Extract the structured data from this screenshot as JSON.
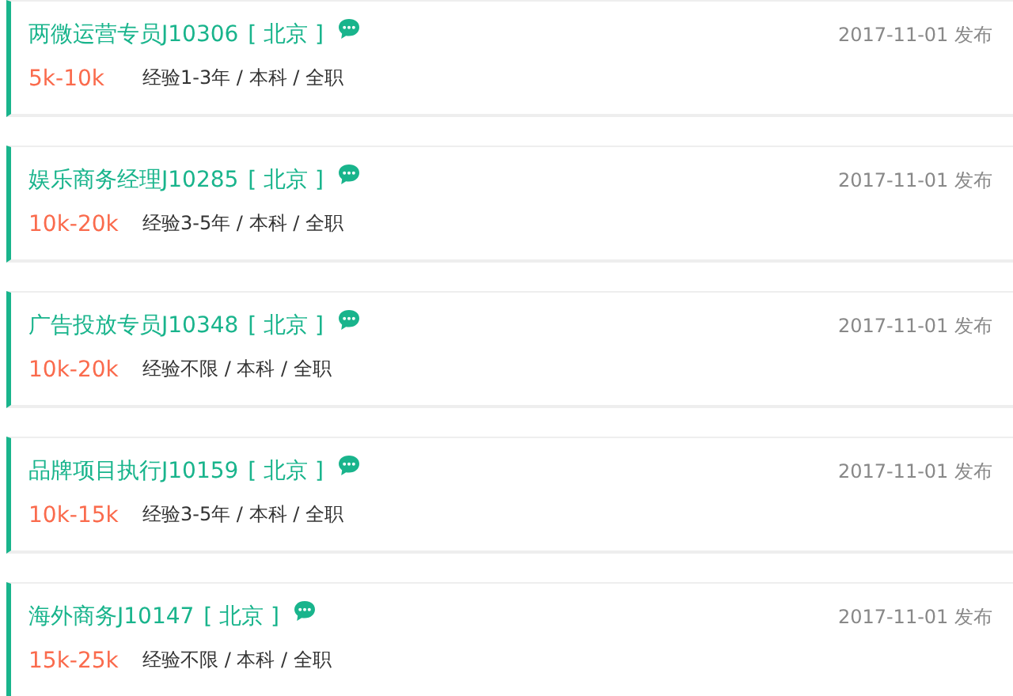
{
  "jobs": [
    {
      "title": "两微运营专员J10306",
      "city": "[ 北京 ]",
      "salary": "5k-10k",
      "requirements": "经验1-3年 / 本科 / 全职",
      "date": "2017-11-01 发布"
    },
    {
      "title": "娱乐商务经理J10285",
      "city": "[ 北京 ]",
      "salary": "10k-20k",
      "requirements": "经验3-5年 / 本科 / 全职",
      "date": "2017-11-01 发布"
    },
    {
      "title": "广告投放专员J10348",
      "city": "[ 北京 ]",
      "salary": "10k-20k",
      "requirements": "经验不限 / 本科 / 全职",
      "date": "2017-11-01 发布"
    },
    {
      "title": "品牌项目执行J10159",
      "city": "[ 北京 ]",
      "salary": "10k-15k",
      "requirements": "经验3-5年 / 本科 / 全职",
      "date": "2017-11-01 发布"
    },
    {
      "title": "海外商务J10147",
      "city": "[ 北京 ]",
      "salary": "15k-25k",
      "requirements": "经验不限 / 本科 / 全职",
      "date": "2017-11-01 发布"
    }
  ]
}
